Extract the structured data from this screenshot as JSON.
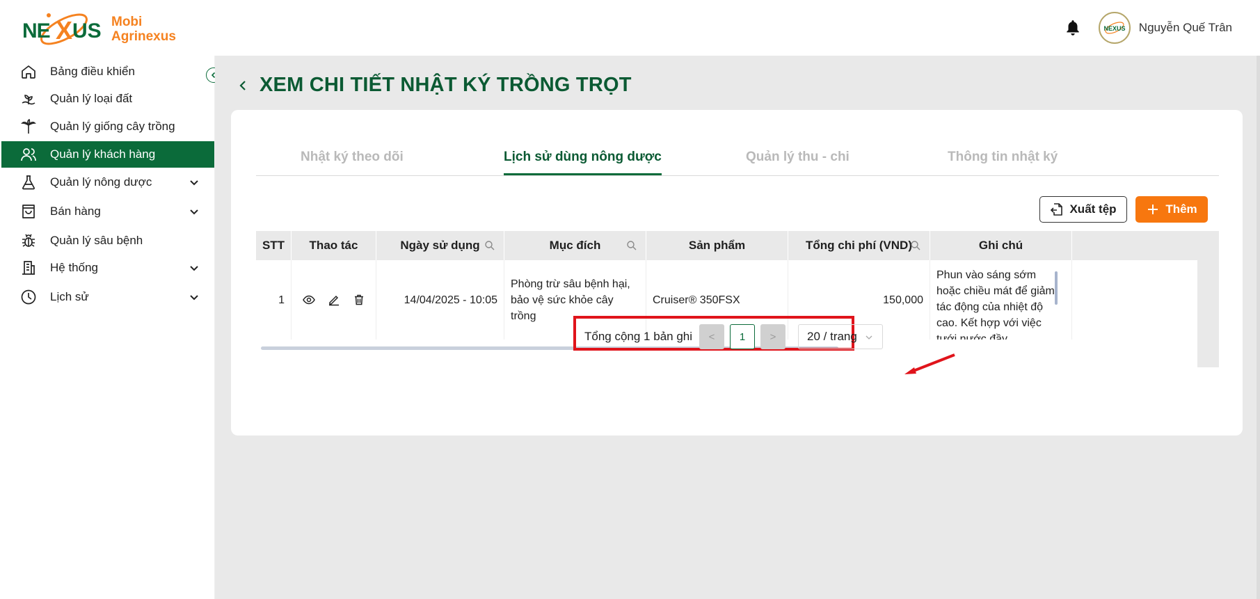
{
  "brand": {
    "line1": "Mobi",
    "line2": "Agrinexus",
    "mark_text": "NEXUS"
  },
  "header": {
    "user_name": "Nguyễn Quế Trân",
    "avatar_text": "NEXUS"
  },
  "sidebar": {
    "items": [
      {
        "label": "Bảng điều khiển",
        "icon": "home-icon",
        "has_chevron": false,
        "active": false
      },
      {
        "label": "Quản lý loại đất",
        "icon": "soil-icon",
        "has_chevron": false,
        "active": false
      },
      {
        "label": "Quản lý giống cây trồng",
        "icon": "plant-icon",
        "has_chevron": false,
        "active": false
      },
      {
        "label": "Quản lý khách hàng",
        "icon": "users-icon",
        "has_chevron": false,
        "active": true
      },
      {
        "label": "Quản lý nông dược",
        "icon": "flask-icon",
        "has_chevron": true,
        "active": false
      },
      {
        "label": "Bán hàng",
        "icon": "shopping-bag-icon",
        "has_chevron": true,
        "active": false
      },
      {
        "label": "Quản lý sâu bệnh",
        "icon": "bug-icon",
        "has_chevron": false,
        "active": false
      },
      {
        "label": "Hệ thống",
        "icon": "building-icon",
        "has_chevron": true,
        "active": false
      },
      {
        "label": "Lịch sử",
        "icon": "clock-icon",
        "has_chevron": true,
        "active": false
      }
    ]
  },
  "page": {
    "title": "XEM CHI TIẾT NHẬT KÝ TRỒNG TRỌT"
  },
  "tabs": [
    {
      "label": "Nhật ký theo dõi",
      "active": false
    },
    {
      "label": "Lịch sử dùng nông dược",
      "active": true
    },
    {
      "label": "Quản lý thu - chi",
      "active": false
    },
    {
      "label": "Thông tin nhật ký",
      "active": false
    }
  ],
  "toolbar": {
    "export_label": "Xuất tệp",
    "add_label": "Thêm"
  },
  "table": {
    "columns": [
      "STT",
      "Thao tác",
      "Ngày sử dụng",
      "Mục đích",
      "Sản phẩm",
      "Tổng chi phí (VND)",
      "Ghi chú"
    ],
    "rows": [
      {
        "stt": "1",
        "date": "14/04/2025 - 10:05",
        "purpose": "Phòng trừ sâu bệnh hại, bảo vệ sức khỏe cây trồng",
        "product": "Cruiser® 350FSX",
        "cost": "150,000",
        "note": "Phun vào sáng sớm hoặc chiều mát để giảm tác động của nhiệt độ cao. Kết hợp với việc tưới nước đầy"
      }
    ]
  },
  "pagination": {
    "total_text": "Tổng cộng 1 bản ghi",
    "current_page": "1",
    "prev": "<",
    "next": ">",
    "page_size": "20 / trang"
  },
  "colors": {
    "primary": "#0b6b3a",
    "accent": "#f7770f",
    "highlight": "#e0141b"
  }
}
